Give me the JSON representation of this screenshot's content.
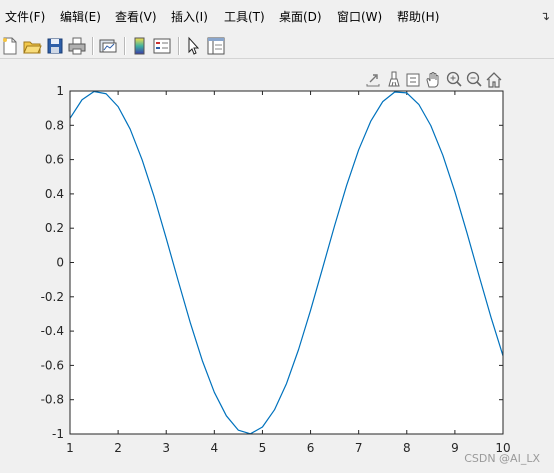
{
  "menus": [
    "文件(F)",
    "编辑(E)",
    "查看(V)",
    "插入(I)",
    "工具(T)",
    "桌面(D)",
    "窗口(W)",
    "帮助(H)"
  ],
  "menu_overflow_icon": "dock-arrow-icon",
  "toolbar": {
    "buttons": [
      "new-figure-icon",
      "open-file-icon",
      "save-icon",
      "print-icon",
      "link-plot-icon",
      "colorbar-icon",
      "legend-icon",
      "edit-plot-icon",
      "property-inspector-icon"
    ]
  },
  "axes_toolbar": {
    "buttons": [
      "export-icon",
      "brush-icon",
      "data-tips-icon",
      "pan-icon",
      "zoom-in-icon",
      "zoom-out-icon",
      "home-icon"
    ]
  },
  "watermark": "CSDN @AI_LX",
  "colors": {
    "line": "#0072bd",
    "axes": "#262626",
    "background": "#ffffff",
    "window": "#f0f0f0"
  },
  "chart_data": {
    "type": "line",
    "title": "",
    "xlabel": "",
    "ylabel": "",
    "xlim": [
      1,
      10
    ],
    "ylim": [
      -1,
      1
    ],
    "xticks": [
      1,
      2,
      3,
      4,
      5,
      6,
      7,
      8,
      9,
      10
    ],
    "xtick_labels": [
      "1",
      "2",
      "3",
      "4",
      "5",
      "6",
      "7",
      "8",
      "9",
      "10"
    ],
    "yticks": [
      -1,
      -0.8,
      -0.6,
      -0.4,
      -0.2,
      0,
      0.2,
      0.4,
      0.6,
      0.8,
      1
    ],
    "ytick_labels": [
      "-1",
      "-0.8",
      "-0.6",
      "-0.4",
      "-0.2",
      "0",
      "0.2",
      "0.4",
      "0.6",
      "0.8",
      "1"
    ],
    "grid": false,
    "series": [
      {
        "color": "#0072bd",
        "x": [
          1,
          1.25,
          1.5,
          1.75,
          2,
          2.25,
          2.5,
          2.75,
          3,
          3.25,
          3.5,
          3.75,
          4,
          4.25,
          4.5,
          4.75,
          5,
          5.25,
          5.5,
          5.75,
          6,
          6.25,
          6.5,
          6.75,
          7,
          7.25,
          7.5,
          7.75,
          8,
          8.25,
          8.5,
          8.75,
          9,
          9.25,
          9.5,
          9.75,
          10
        ],
        "y": [
          0.841,
          0.949,
          0.997,
          0.984,
          0.909,
          0.778,
          0.598,
          0.382,
          0.141,
          -0.108,
          -0.351,
          -0.572,
          -0.757,
          -0.894,
          -0.978,
          -0.999,
          -0.959,
          -0.859,
          -0.706,
          -0.508,
          -0.279,
          -0.033,
          0.215,
          0.45,
          0.657,
          0.823,
          0.938,
          0.994,
          0.989,
          0.922,
          0.798,
          0.625,
          0.412,
          0.174,
          -0.075,
          -0.319,
          -0.544
        ]
      }
    ]
  }
}
